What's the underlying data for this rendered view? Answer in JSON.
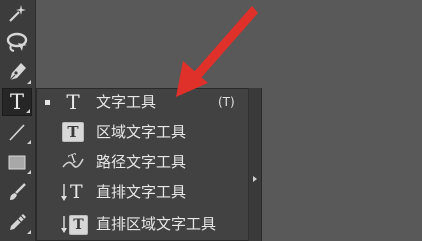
{
  "toolbar": {
    "tools": [
      {
        "name": "magic-wand-icon"
      },
      {
        "name": "lasso-icon"
      },
      {
        "name": "pen-icon"
      },
      {
        "name": "type-tool-icon",
        "active": true,
        "glyph": "T"
      },
      {
        "name": "line-segment-icon"
      },
      {
        "name": "rectangle-icon"
      },
      {
        "name": "paintbrush-icon"
      },
      {
        "name": "pencil-icon"
      }
    ]
  },
  "flyout": {
    "items": [
      {
        "label": "文字工具",
        "shortcut": "(T)",
        "selected": true,
        "icon": "type-icon",
        "glyph": "T"
      },
      {
        "label": "区域文字工具",
        "icon": "area-type-icon",
        "glyph": "T"
      },
      {
        "label": "路径文字工具",
        "icon": "type-on-path-icon",
        "glyph": "T"
      },
      {
        "label": "直排文字工具",
        "icon": "vertical-type-icon",
        "glyph": "T"
      },
      {
        "label": "直排区域文字工具",
        "icon": "vertical-area-type-icon",
        "glyph": "T"
      }
    ]
  },
  "colors": {
    "background": "#595959",
    "toolbar": "#3c3c3c",
    "menu": "#424242",
    "text": "#e8e8e8",
    "annotation_arrow": "#e0302a"
  }
}
